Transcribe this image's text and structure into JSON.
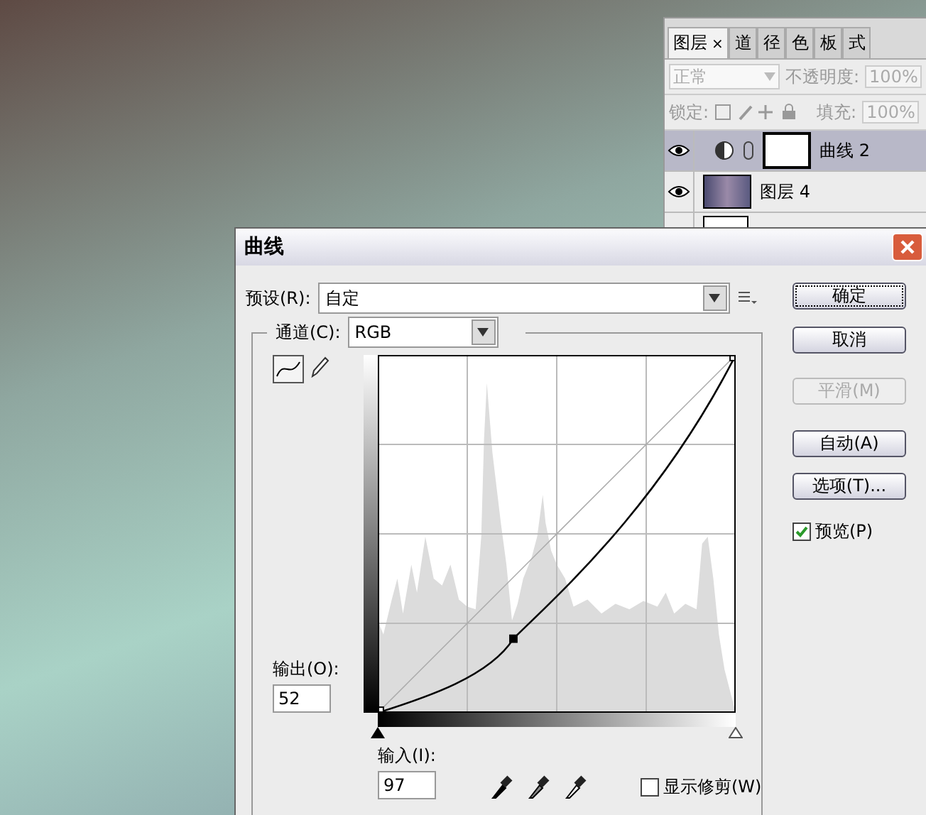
{
  "layers_panel": {
    "tabs": [
      {
        "label": "图层",
        "close": "×",
        "selected": true
      },
      {
        "label": "道",
        "selected": false
      },
      {
        "label": "径",
        "selected": false
      },
      {
        "label": "色",
        "selected": false
      },
      {
        "label": "板",
        "selected": false
      },
      {
        "label": "式",
        "selected": false
      }
    ],
    "blend_mode": "正常",
    "opacity_label": "不透明度:",
    "opacity": "100%",
    "lock_label": "锁定:",
    "fill_label": "填充:",
    "fill": "100%",
    "layers": [
      {
        "name": "曲线 2",
        "kind": "adjustment",
        "visible": true,
        "selected": true
      },
      {
        "name": "图层 4",
        "kind": "image",
        "visible": true,
        "selected": false
      }
    ]
  },
  "dialog": {
    "title": "曲线",
    "preset_label": "预设(R):",
    "preset": "自定",
    "channel_label": "通道(C):",
    "channel": "RGB",
    "input_sliders": [
      {
        "kind": "shadow",
        "level": 0
      },
      {
        "kind": "highlight",
        "level": 1
      }
    ],
    "output_label": "输出(O):",
    "output": "52",
    "input_label": "输入(I):",
    "input": "97",
    "show_clipping": {
      "label": "显示修剪(W)",
      "checked": false
    },
    "buttons": [
      {
        "label": "确定",
        "focused": true,
        "disabled": false
      },
      {
        "label": "取消",
        "focused": false,
        "disabled": false
      },
      {
        "label": "平滑(M)",
        "focused": false,
        "disabled": true
      },
      {
        "label": "自动(A)",
        "focused": false,
        "disabled": false
      },
      {
        "label": "选项(T)...",
        "focused": false,
        "disabled": false
      }
    ],
    "preview": {
      "label": "预览(P)",
      "checked": true
    }
  }
}
